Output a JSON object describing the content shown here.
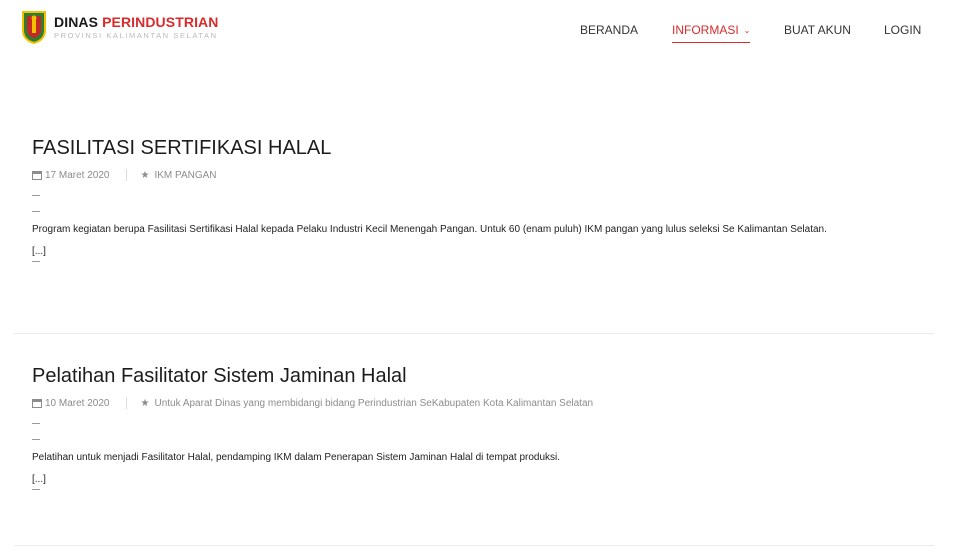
{
  "header": {
    "brand_part1": "DINAS ",
    "brand_part2": "PERINDUSTRIAN",
    "brand_sub": "PROVINSI KALIMANTAN SELATAN",
    "logo_icon": "province-crest-icon",
    "accent_color": "#d92b2b"
  },
  "nav": {
    "beranda": "BERANDA",
    "informasi": "INFORMASI",
    "buat_akun": "BUAT AKUN",
    "login": "LOGIN",
    "active": "INFORMASI"
  },
  "articles": [
    {
      "title": "FASILITASI SERTIFIKASI HALAL",
      "date": "17 Maret 2020",
      "category": "IKM PANGAN",
      "body": "Program kegiatan berupa Fasilitasi Sertifikasi Halal kepada Pelaku Industri Kecil Menengah Pangan. Untuk 60 (enam puluh) IKM pangan yang lulus seleksi Se Kalimantan Selatan.",
      "more": "[...]"
    },
    {
      "title": "Pelatihan Fasilitator Sistem Jaminan Halal",
      "date": "10 Maret 2020",
      "category": "Untuk Aparat Dinas yang membidangi bidang Perindustrian SeKabupaten Kota Kalimantan Selatan",
      "body": "Pelatihan untuk menjadi Fasilitator Halal, pendamping IKM dalam Penerapan Sistem Jaminan Halal di tempat produksi.",
      "more": "[...]"
    }
  ]
}
